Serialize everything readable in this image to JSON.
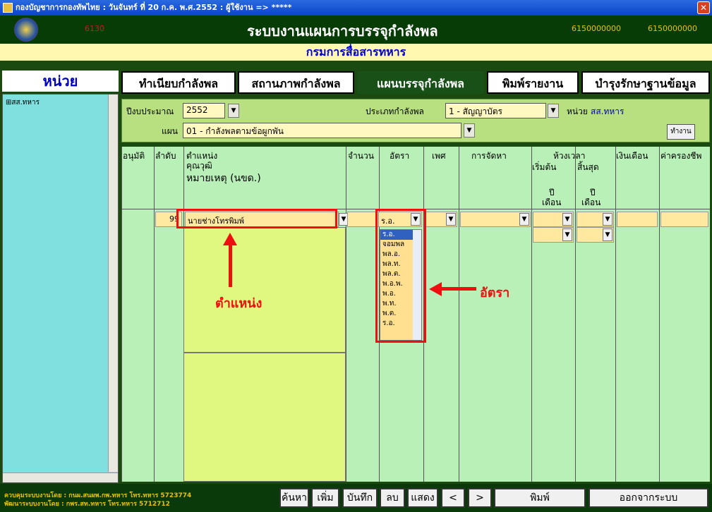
{
  "window": {
    "title": "กองบัญชาการกองทัพไทย : วันจันทร์  ที่ 20 ก.ค.  พ.ศ.2552 : ผู้ใช้งาน => *****",
    "close_glyph": "✕"
  },
  "header": {
    "code": "6130",
    "title": "ระบบงานแผนการบรรจุกำลังพล",
    "num1": "6150000000",
    "num2": "6150000000"
  },
  "department": "กรมการสื่อสารทหาร",
  "sidebar": {
    "title": "หน่วย",
    "tree_item": "⊞สส.ทหาร"
  },
  "tabs": [
    "ทำเนียบกำลังพล",
    "สถานภาพกำลังพล",
    "แผนบรรจุกำลังพล",
    "พิมพ์รายงาน",
    "บำรุงรักษาฐานข้อมูล"
  ],
  "filter": {
    "year_label": "ปีงบประมาณ",
    "year_value": "2552",
    "type_label": "ประเภทกำลังพล",
    "type_value": "1 - สัญญาบัตร",
    "unit_label": "หน่วย",
    "unit_value": "สส.ทหาร",
    "plan_label": "แผน",
    "plan_value": "01 - กำลังพลตามข้อผูกพัน",
    "run_button": "ทำงาน"
  },
  "grid": {
    "headers": {
      "approve": "อนุมัติ",
      "order": "ลำดับ",
      "position": "ตำแหน่ง",
      "qual": "คุณวุฒิ",
      "note": "หมายเหตุ (นขด.)",
      "count": "จำนวน",
      "rate": "อัตรา",
      "sex": "เพศ",
      "procure": "การจัดหา",
      "period": "ห้วงเวลา",
      "start": "เริ่มต้น",
      "end": "สิ้นสุด",
      "year": "ปี",
      "month": "เดือน",
      "year2": "ปี",
      "month2": "เดือน",
      "salary": "เงินเดือน",
      "living": "ค่าครองชีพ"
    },
    "row": {
      "order": "99",
      "position": "นายช่างโทรพิมพ์",
      "rate": "ร.อ."
    },
    "rate_options": [
      "ร.อ.",
      "จอมพล",
      "พล.อ.",
      "พล.ท.",
      "พล.ต.",
      "พ.อ.พ.",
      "พ.อ.",
      "พ.ท.",
      "พ.ต.",
      "ร.อ."
    ]
  },
  "annotations": {
    "position": "ตำแหน่ง",
    "rate": "อัตรา"
  },
  "footer": {
    "line1": "ควบคุมระบบงานโดย : กนผ.สนผพ.กพ.ทหาร  โทร.ทหาร  5723774",
    "line2": "พัฒนาระบบงานโดย : กพร.สท.ทหาร         โทร.ทหาร  5712712",
    "buttons": [
      "ค้นหา",
      "เพิ่ม",
      "บันทึก",
      "ลบ",
      "แสดง",
      "<",
      ">",
      "พิมพ์",
      "ออกจากระบบ"
    ]
  }
}
